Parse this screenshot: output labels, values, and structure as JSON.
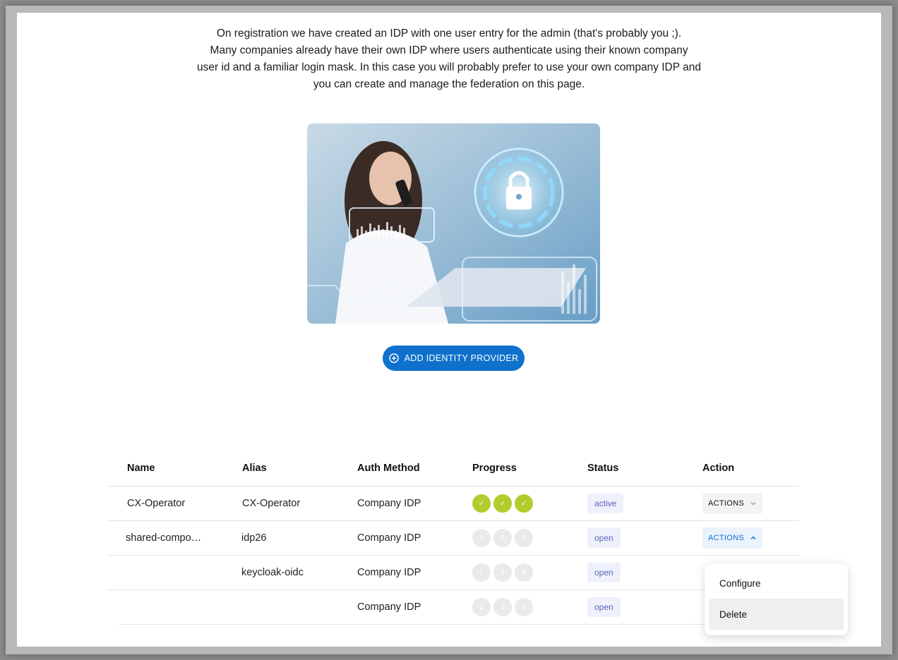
{
  "intro": {
    "line1": "On registration we have created an IDP with one user entry for the admin (that's probably you ;).",
    "line2": "Many companies already have their own IDP where users authenticate using their known company",
    "line3": "user id and a familiar login mask. In this case you will probably prefer to use your own company IDP and",
    "line4": "you can create and manage the federation on this page."
  },
  "add_button": {
    "label": "ADD IDENTITY PROVIDER",
    "icon": "add-circle-icon"
  },
  "table": {
    "headers": {
      "name": "Name",
      "alias": "Alias",
      "auth": "Auth Method",
      "progress": "Progress",
      "status": "Status",
      "action": "Action"
    },
    "rows": [
      {
        "name": "CX-Operator",
        "alias": "CX-Operator",
        "auth": "Company IDP",
        "steps": [
          "✓",
          "✓",
          "✓"
        ],
        "status": "active",
        "action": "ACTIONS"
      },
      {
        "name": "shared-compo…",
        "alias": "idp26",
        "auth": "Company IDP",
        "steps": [
          "1",
          "2",
          "3"
        ],
        "status": "open",
        "action": "ACTIONS"
      },
      {
        "name": "",
        "alias": "keycloak-oidc",
        "auth": "Company IDP",
        "steps": [
          "1",
          "2",
          "3"
        ],
        "status": "open",
        "action": ""
      },
      {
        "name": "",
        "alias": "",
        "auth": "Company IDP",
        "steps": [
          "1",
          "2",
          "3"
        ],
        "status": "open",
        "action": ""
      }
    ]
  },
  "menu": {
    "configure": "Configure",
    "delete": "Delete"
  },
  "colors": {
    "primary": "#0f71cb",
    "success": "#b3cb2d",
    "badge_text": "#5a66b8",
    "badge_bg": "#eef0fb"
  }
}
